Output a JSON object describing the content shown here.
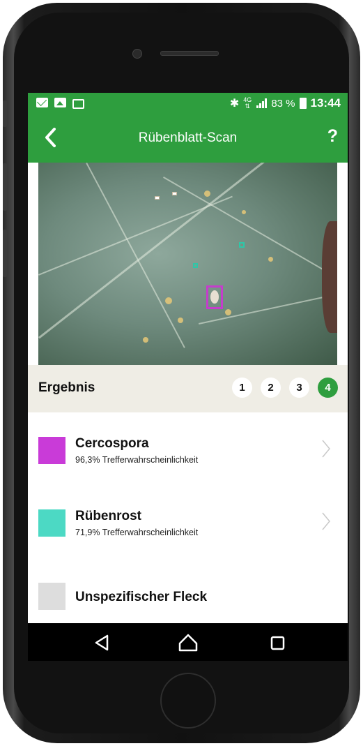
{
  "status_bar": {
    "left_icons": [
      "mail-icon",
      "image-icon",
      "open-mail-icon"
    ],
    "bluetooth_icon": "bluetooth-icon",
    "network": "4G",
    "battery": "83 %",
    "time": "13:44"
  },
  "app_bar": {
    "title": "Rübenblatt-Scan",
    "help": "?",
    "back_icon": "chevron-left-icon"
  },
  "results": {
    "title": "Ergebnis",
    "pages": [
      {
        "label": "1",
        "active": false
      },
      {
        "label": "2",
        "active": false
      },
      {
        "label": "3",
        "active": false
      },
      {
        "label": "4",
        "active": true
      }
    ],
    "items": [
      {
        "name": "Cercospora",
        "probability": "96,3% Trefferwahrscheinlichkeit",
        "color": "#c93bd8"
      },
      {
        "name": "Rübenrost",
        "probability": "71,9% Trefferwahrscheinlichkeit",
        "color": "#4cd9c4"
      },
      {
        "name": "Unspezifischer Fleck",
        "probability": "",
        "color": "#dddddd"
      }
    ]
  },
  "colors": {
    "accent": "#2e9e3e",
    "header_bg": "#efede5"
  },
  "nav_bar": {
    "back_icon": "triangle-back-icon",
    "home_icon": "home-outline-icon",
    "recents_icon": "square-recents-icon"
  }
}
